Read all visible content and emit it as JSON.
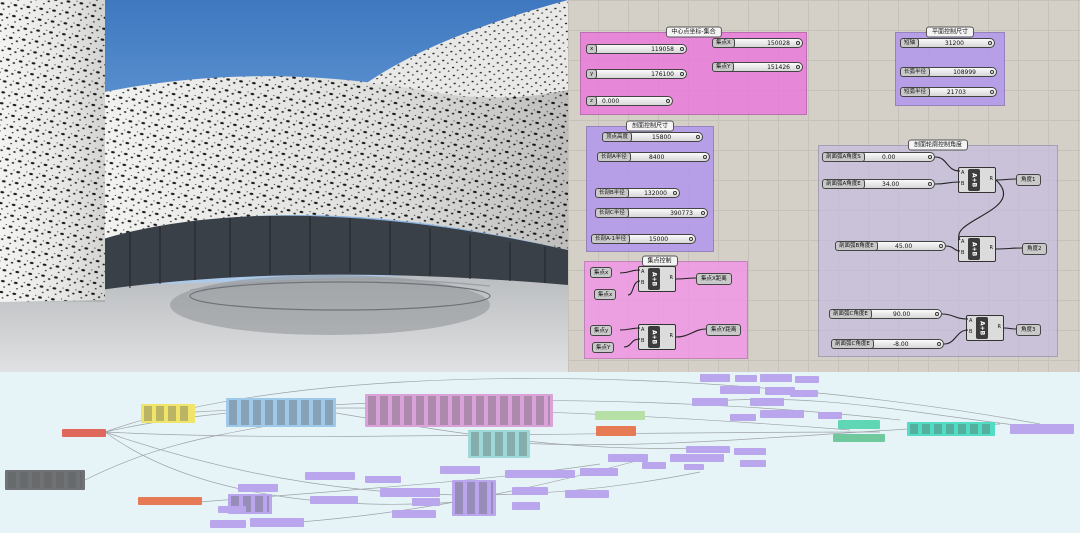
{
  "canvas": {
    "groups": {
      "center_point": "中心点坐标-集合",
      "plan_size": "平面控制尺寸",
      "section_size": "剖面控制尺寸",
      "set_point": "集点控制",
      "section_angle": "剖面轮廓控制角度"
    },
    "center_point": {
      "x": {
        "label": "x",
        "value": "119058"
      },
      "y": {
        "label": "y",
        "value": "176100"
      },
      "z": {
        "label": "z",
        "value": "0.000"
      },
      "set_x": {
        "label": "集点X",
        "value": "150028"
      },
      "set_y": {
        "label": "集点Y",
        "value": "151426"
      }
    },
    "plan_size": {
      "short_axis": {
        "label": "短轴",
        "value": "31200"
      },
      "long_radius": {
        "label": "长弧半径",
        "value": "108999"
      },
      "short_radius": {
        "label": "短弧半径",
        "value": "21703"
      }
    },
    "section_size": {
      "apex_height": {
        "label": "顶点高度",
        "value": "15800"
      },
      "long_a_radius": {
        "label": "长剖A半径",
        "value": "8400"
      },
      "long_b_radius": {
        "label": "长剖B半径",
        "value": "132000"
      },
      "long_c_radius": {
        "label": "长剖C半径",
        "value": "390773"
      },
      "long_a1_radius": {
        "label": "长剖A-1半径",
        "value": "15000"
      }
    },
    "set_point": {
      "in_x": "集点x",
      "in_x2": "集点x",
      "out_x": "集点X距离",
      "in_y": "集点y",
      "in_y2": "集点Y",
      "out_y": "集点Y距离"
    },
    "section_angle": {
      "a_angle_s": {
        "label": "剖面弧A角度S",
        "value": "0.00"
      },
      "a_angle_e": {
        "label": "剖面弧A角度E",
        "value": "34.00"
      },
      "b_angle_e": {
        "label": "剖面弧B角度E",
        "value": "45.00"
      },
      "c_angle_e1": {
        "label": "剖面弧C角度E",
        "value": "90.00"
      },
      "c_angle_e2": {
        "label": "剖面弧C角度E",
        "value": "-8.00"
      },
      "out_1": "角度1",
      "out_2": "角度2",
      "out_3": "角度3"
    },
    "component": {
      "a": "A",
      "b": "B",
      "r": "R",
      "op": "A+B"
    }
  },
  "colors": {
    "pink_group": "#ec76dc",
    "purple_group": "#b296ec",
    "canvas_bg": "#d4d0c8",
    "overview_bg": "#e7f4f7"
  }
}
